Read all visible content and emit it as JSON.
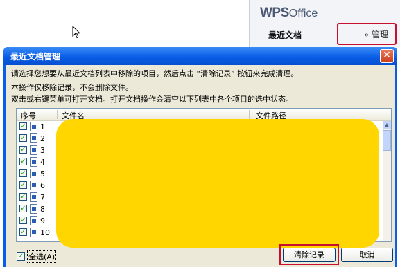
{
  "background_app": {
    "logo_bold": "WPS",
    "logo_light": "Office",
    "recent_docs_label": "最近文档",
    "manage_link": "» 管理"
  },
  "dialog": {
    "title": "最近文档管理",
    "close_symbol": "✕",
    "instructions": [
      "请选择您想要从最近文档列表中移除的项目，然后点击 “清除记录” 按钮来完成清理。",
      "本操作仅移除记录，不会删除文件。",
      "双击或右键菜单可打开文档。打开文档操作会清空以下列表中各个项目的选中状态。"
    ],
    "columns": [
      "序号",
      "文件名",
      "文件路径"
    ],
    "rows": [
      {
        "index": "1",
        "checked": true,
        "icon": "word-doc-icon"
      },
      {
        "index": "2",
        "checked": true,
        "icon": "word-doc-icon"
      },
      {
        "index": "3",
        "checked": true,
        "icon": "word-doc-icon"
      },
      {
        "index": "4",
        "checked": true,
        "icon": "word-doc-icon"
      },
      {
        "index": "5",
        "checked": true,
        "icon": "word-doc-icon"
      },
      {
        "index": "6",
        "checked": true,
        "icon": "word-doc-icon"
      },
      {
        "index": "7",
        "checked": true,
        "icon": "word-doc-icon"
      },
      {
        "index": "8",
        "checked": true,
        "icon": "word-doc-icon"
      },
      {
        "index": "9",
        "checked": true,
        "icon": "word-doc-icon"
      },
      {
        "index": "10",
        "checked": true,
        "icon": "word-doc-icon"
      }
    ],
    "select_all_label": "全选(A)",
    "clear_button": "清除记录",
    "cancel_button": "取消"
  },
  "colors": {
    "titlebar": "#0a5de6",
    "highlight_frame": "#c8102e",
    "redaction": "#ffd600"
  }
}
